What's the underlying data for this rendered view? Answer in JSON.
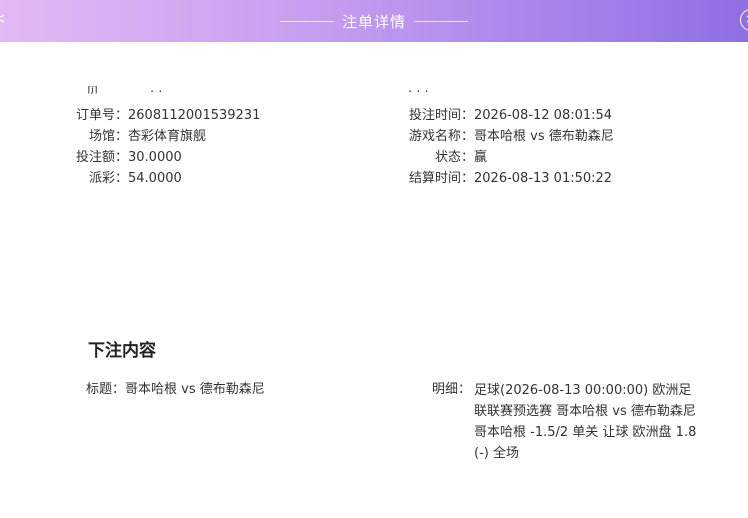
{
  "header": {
    "title": "注单详情",
    "close_glyph": "×",
    "left_glyph": "<",
    "accent_from": "#e2b9f4",
    "accent_to": "#8f6ee4"
  },
  "clipped": {
    "left": "贝",
    "left_dots": "·    ·",
    "right": "·  ·  ·"
  },
  "order": {
    "left": [
      {
        "label": "订单号：",
        "value": "2608112001539231"
      },
      {
        "label": "场馆：",
        "value": "杏彩体育旗舰"
      },
      {
        "label": "投注额：",
        "value": "30.0000"
      },
      {
        "label": "派彩：",
        "value": "54.0000"
      }
    ],
    "right": [
      {
        "label": "投注时间：",
        "value": "2026-08-12 08:01:54"
      },
      {
        "label": "游戏名称：",
        "value": "哥本哈根 vs 德布勒森尼"
      },
      {
        "label": "状态：",
        "value": "赢"
      },
      {
        "label": "结算时间：",
        "value": "2026-08-13 01:50:22"
      }
    ]
  },
  "bet": {
    "section_title": "下注内容",
    "title_label": "标题：",
    "title_value": "哥本哈根 vs 德布勒森尼",
    "detail_label": "明细：",
    "detail_value": "足球(2026-08-13 00:00:00) 欧洲足联联赛预选赛 哥本哈根 vs 德布勒森尼 哥本哈根 -1.5/2 单关 让球 欧洲盘 1.8 (-) 全场"
  }
}
